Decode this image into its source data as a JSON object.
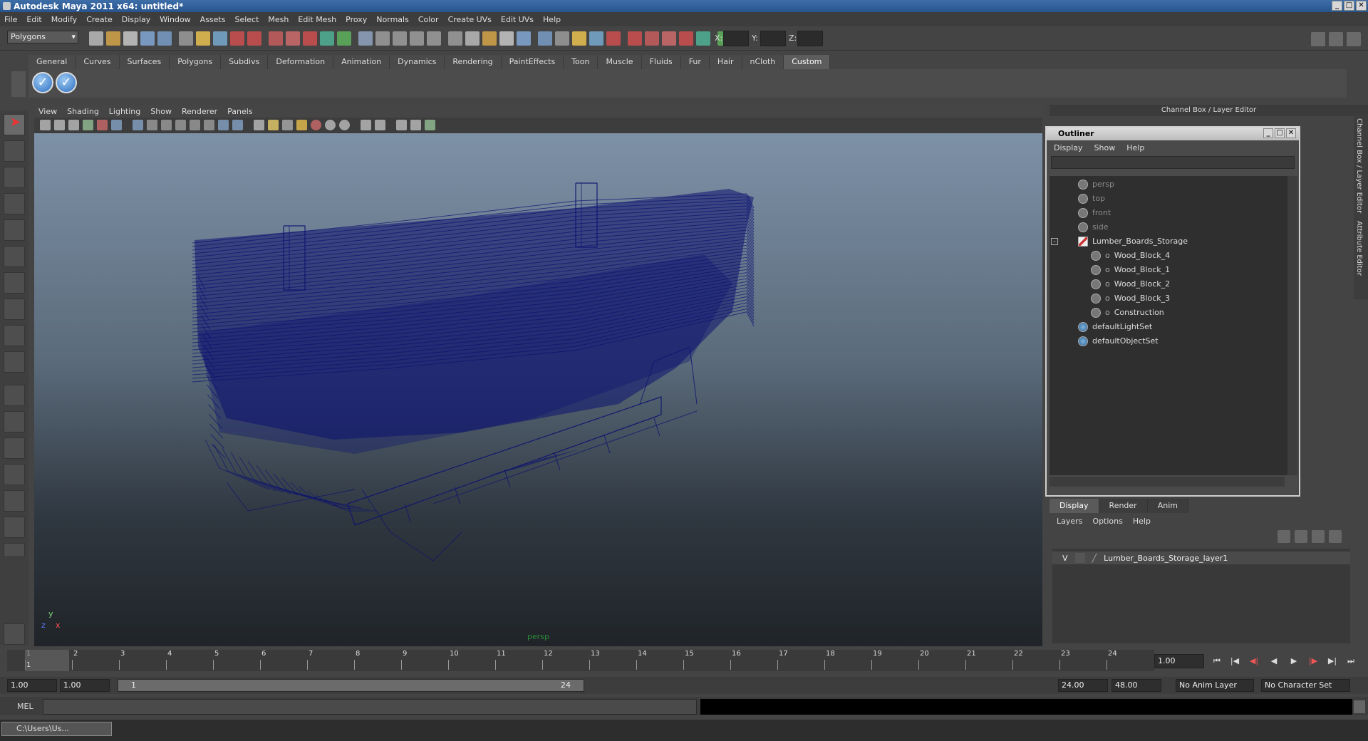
{
  "window": {
    "title": "Autodesk Maya 2011 x64: untitled*",
    "min": "_",
    "max": "□",
    "close": "✕"
  },
  "menu": [
    "File",
    "Edit",
    "Modify",
    "Create",
    "Display",
    "Window",
    "Assets",
    "Select",
    "Mesh",
    "Edit Mesh",
    "Proxy",
    "Normals",
    "Color",
    "Create UVs",
    "Edit UVs",
    "Help"
  ],
  "status": {
    "mode": "Polygons",
    "x_label": "X:",
    "y_label": "Y:",
    "z_label": "Z:"
  },
  "shelf_tabs": [
    "General",
    "Curves",
    "Surfaces",
    "Polygons",
    "Subdivs",
    "Deformation",
    "Animation",
    "Dynamics",
    "Rendering",
    "PaintEffects",
    "Toon",
    "Muscle",
    "Fluids",
    "Fur",
    "Hair",
    "nCloth",
    "Custom"
  ],
  "shelf_active": "Custom",
  "panel_menu": [
    "View",
    "Shading",
    "Lighting",
    "Show",
    "Renderer",
    "Panels"
  ],
  "viewport": {
    "camera": "persp",
    "axis_y": "y",
    "axis_x": "x",
    "axis_z": "z",
    "wire_color": "#0c1270"
  },
  "channel_box": {
    "title": "Channel Box / Layer Editor",
    "side_tab_1": "Channel Box / Layer Editor",
    "side_tab_2": "Attribute Editor"
  },
  "outliner": {
    "title": "Outliner",
    "menu": [
      "Display",
      "Show",
      "Help"
    ],
    "items": [
      {
        "label": "persp",
        "dim": true,
        "indent": 0
      },
      {
        "label": "top",
        "dim": true,
        "indent": 0
      },
      {
        "label": "front",
        "dim": true,
        "indent": 0
      },
      {
        "label": "side",
        "dim": true,
        "indent": 0
      },
      {
        "label": "Lumber_Boards_Storage",
        "dim": false,
        "indent": 0
      },
      {
        "label": "Wood_Block_4",
        "dim": false,
        "indent": 1
      },
      {
        "label": "Wood_Block_1",
        "dim": false,
        "indent": 1
      },
      {
        "label": "Wood_Block_2",
        "dim": false,
        "indent": 1
      },
      {
        "label": "Wood_Block_3",
        "dim": false,
        "indent": 1
      },
      {
        "label": "Construction",
        "dim": false,
        "indent": 1
      },
      {
        "label": "defaultLightSet",
        "dim": false,
        "indent": 0
      },
      {
        "label": "defaultObjectSet",
        "dim": false,
        "indent": 0
      }
    ]
  },
  "layers": {
    "tabs": [
      "Display",
      "Render",
      "Anim"
    ],
    "active": "Display",
    "menu": [
      "Layers",
      "Options",
      "Help"
    ],
    "rows": [
      {
        "visible": "V",
        "name": "Lumber_Boards_Storage_layer1"
      }
    ]
  },
  "timeline": {
    "ticks": [
      "1",
      "2",
      "3",
      "4",
      "5",
      "6",
      "7",
      "8",
      "9",
      "10",
      "11",
      "12",
      "13",
      "14",
      "15",
      "16",
      "17",
      "18",
      "19",
      "20",
      "21",
      "22",
      "23",
      "24"
    ],
    "current": "1",
    "current_frame": "1.00"
  },
  "range": {
    "start": "1.00",
    "start2": "1.00",
    "slider_start": "1",
    "slider_end": "24",
    "end": "24.00",
    "end2": "48.00",
    "anim_layer": "No Anim Layer",
    "char_set": "No Character Set"
  },
  "cmd": {
    "label": "MEL"
  },
  "taskbar": {
    "item": "C:\\Users\\Us..."
  }
}
